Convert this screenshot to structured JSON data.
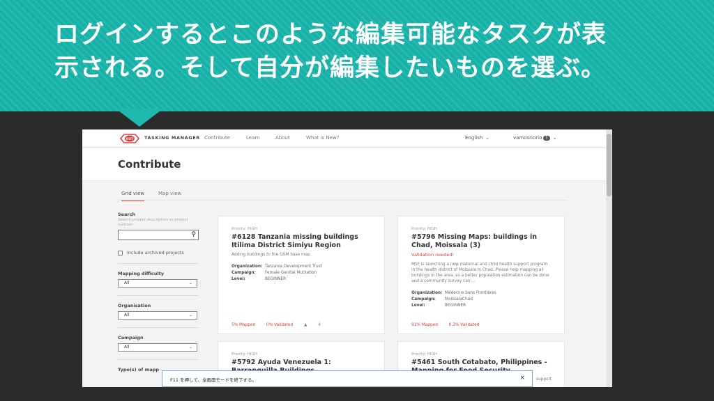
{
  "slide": {
    "title_line1": "ログインするとこのような編集可能なタスクが表",
    "title_line2": "示される。そして自分が編集したいものを選ぶ。"
  },
  "navbar": {
    "brand": "TASKING MANAGER",
    "links": [
      "Contribute",
      "Learn",
      "About",
      "What is New?"
    ],
    "language": "English",
    "username": "vamosriorio",
    "badge": "1"
  },
  "page": {
    "title": "Contribute"
  },
  "tabs": [
    "Grid view",
    "Map view"
  ],
  "filters": {
    "search_label": "Search",
    "search_hint": "Search project description or project number",
    "include_archived": "Include archived projects",
    "mapping_difficulty_label": "Mapping difficulty",
    "mapping_difficulty_value": "All",
    "organisation_label": "Organisation",
    "organisation_value": "All",
    "campaign_label": "Campaign",
    "campaign_value": "All",
    "types_label": "Type(s) of mapp"
  },
  "cards": [
    {
      "priority": "Priority: HIGH",
      "title": "#6128 Tanzania missing buildings Itilima District Simiyu Region",
      "validation": "",
      "description": "Adding buildings to the OSM base map",
      "organization_label": "Organization:",
      "organization": "Tanzania Development Trust",
      "campaign_label": "Campaign:",
      "campaign": "Female Genital Mutilation",
      "level_label": "Level:",
      "level": "BEGINNER",
      "mapped": "5% Mapped",
      "validated": "0% Validated",
      "contributors": "4"
    },
    {
      "priority": "Priority: HIGH",
      "title": "#5796 Missing Maps: buildings in Chad, Moissala (3)",
      "validation": "Validation needed!",
      "description": "MSF is launching a new maternal and child health support program in the health district of Moissala in Chad. Please help mapping all buildings in the area, so a better population estimation can be done and a community survey can ...",
      "organization_label": "Organization:",
      "organization": "Médecins Sans Frontières",
      "campaign_label": "Campaign:",
      "campaign": "MoissalaChad",
      "level_label": "Level:",
      "level": "BEGINNER",
      "mapped": "91% Mapped",
      "validated": "0.3% Validated",
      "contributors": ""
    },
    {
      "priority": "Priority: HIGH",
      "title": "#5792 Ayuda Venezuela 1: Barranquilla Buildings"
    },
    {
      "priority": "Priority: HIGH",
      "title": "#5461 South Cotabato, Philippines - Mapping for Food Security",
      "description": "support"
    }
  ],
  "toast": {
    "text": "F11 を押して、全画面モードを終了する。",
    "close": "×"
  },
  "colors": {
    "banner": "#16b2a8",
    "accent_red": "#d73f3f"
  }
}
